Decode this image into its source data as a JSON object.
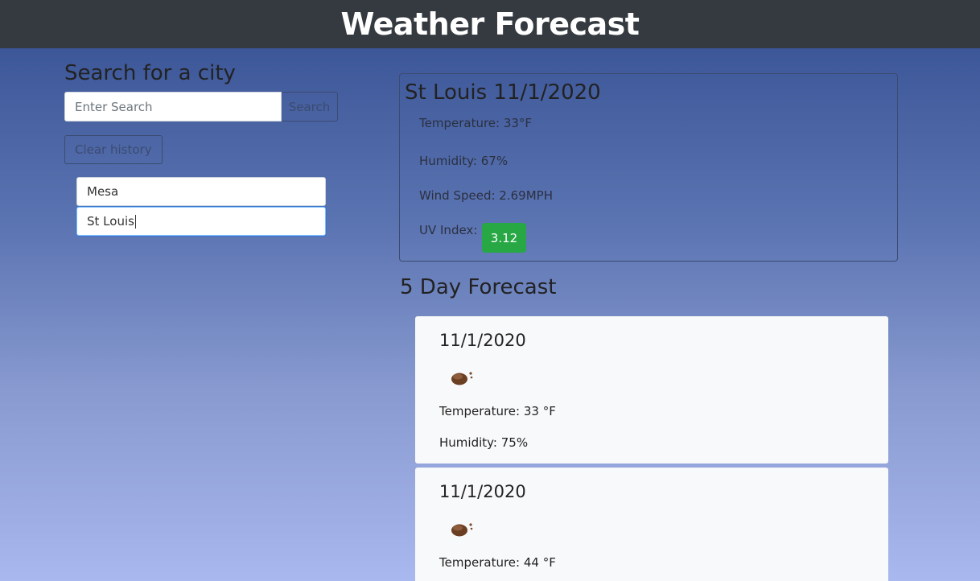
{
  "header": {
    "title": "Weather Forecast"
  },
  "search": {
    "title": "Search for a city",
    "placeholder": "Enter Search",
    "button_label": "Search",
    "clear_label": "Clear history"
  },
  "history": [
    {
      "city": "Mesa"
    },
    {
      "city": "St Louis"
    }
  ],
  "current": {
    "title": "St Louis 11/1/2020",
    "temperature": "Temperature:  33°F",
    "humidity": "Humidity:  67%",
    "wind": "Wind Speed:  2.69MPH",
    "uv_label": "UV Index:",
    "uv_value": "3.12",
    "uv_color": "#28a745"
  },
  "forecast": {
    "title": "5 Day Forecast",
    "days": [
      {
        "date": "11/1/2020",
        "icon": "cloudy-night-icon",
        "temperature": "Temperature: 33 °F",
        "humidity": "Humidity: 75%"
      },
      {
        "date": "11/1/2020",
        "icon": "cloudy-night-icon",
        "temperature": "Temperature: 44 °F"
      }
    ]
  }
}
